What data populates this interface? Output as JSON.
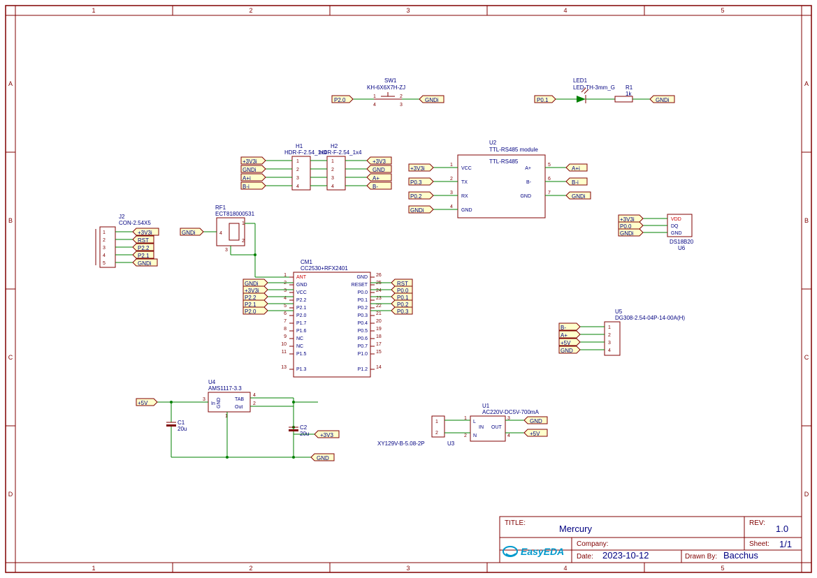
{
  "sheet": {
    "title_label": "TITLE:",
    "title": "Mercury",
    "rev_label": "REV:",
    "rev": "1.0",
    "company_label": "Company:",
    "company": "",
    "sheet_label": "Sheet:",
    "sheet": "1/1",
    "date_label": "Date:",
    "date": "2023-10-12",
    "drawn_by_label": "Drawn By:",
    "drawn_by": "Bacchus",
    "logo": "EasyEDA"
  },
  "ruler": {
    "cols": [
      "1",
      "2",
      "3",
      "4",
      "5"
    ],
    "rows": [
      "A",
      "B",
      "C",
      "D"
    ]
  },
  "components": {
    "sw1": {
      "ref": "SW1",
      "val": "KH-6X6X7H-ZJ",
      "pins": [
        "1",
        "2",
        "4",
        "3"
      ]
    },
    "led1": {
      "ref": "LED1",
      "val": "LED-TH-3mm_G"
    },
    "r1": {
      "ref": "R1",
      "val": "1k"
    },
    "h1": {
      "ref": "H1",
      "val": "HDR-F-2.54_1x4",
      "pins": [
        "1",
        "2",
        "3",
        "4"
      ]
    },
    "h2": {
      "ref": "H2",
      "val": "HDR-F-2.54_1x4",
      "pins": [
        "1",
        "2",
        "3",
        "4"
      ]
    },
    "u2": {
      "ref": "U2",
      "val": "TTL-RS485 module",
      "name": "TTL-RS485",
      "left": [
        "VCC",
        "TX",
        "RX",
        "GND"
      ],
      "leftnum": [
        "1",
        "2",
        "3",
        "4"
      ],
      "right": [
        "A+",
        "B-",
        "GND"
      ],
      "rightnum": [
        "5",
        "6",
        "7"
      ]
    },
    "j2": {
      "ref": "J2",
      "val": "CON-2.54X5",
      "pins": [
        "1",
        "2",
        "3",
        "4",
        "5"
      ]
    },
    "rf1": {
      "ref": "RF1",
      "val": "ECT818000531",
      "pins": [
        "1",
        "2",
        "3",
        "4"
      ]
    },
    "cm1": {
      "ref": "CM1",
      "val": "CC2530+RFX2401",
      "left_names": [
        "ANT",
        "GND",
        "VCC",
        "P2.2",
        "P2.1",
        "P2.0",
        "P1.7",
        "P1.6",
        "NC",
        "NC",
        "P1.5",
        "",
        "P1.3"
      ],
      "left_nums": [
        "1",
        "2",
        "3",
        "4",
        "5",
        "6",
        "7",
        "8",
        "9",
        "10",
        "11",
        "",
        "13"
      ],
      "right_names": [
        "GND",
        "RESET",
        "P0.0",
        "P0.1",
        "P0.2",
        "P0.3",
        "P0.4",
        "P0.5",
        "P0.6",
        "P0.7",
        "P1.0",
        "",
        "P1.2"
      ],
      "right_nums": [
        "26",
        "25",
        "24",
        "23",
        "22",
        "21",
        "20",
        "19",
        "18",
        "17",
        "15",
        "",
        "14"
      ]
    },
    "u6": {
      "ref": "U6",
      "val": "DS18B20",
      "pins": [
        "VDD",
        "DQ",
        "GND"
      ]
    },
    "u5": {
      "ref": "U5",
      "val": "DG308-2.54-04P-14-00A(H)",
      "pins": [
        "1",
        "2",
        "3",
        "4"
      ]
    },
    "u4": {
      "ref": "U4",
      "val": "AMS1117-3.3",
      "pins": {
        "in": "3",
        "tab": "4",
        "out": "2",
        "gnd": "1"
      },
      "labels": {
        "in": "In",
        "tab": "TAB",
        "out": "Out",
        "gnd": "GND"
      }
    },
    "c1": {
      "ref": "C1",
      "val": "20u"
    },
    "c2": {
      "ref": "C2",
      "val": "20u"
    },
    "u1": {
      "ref": "U1",
      "val": "AC220V-DC5V-700mA",
      "pins": [
        "L",
        "N",
        "OUT",
        "IN"
      ],
      "nums": [
        "1",
        "2",
        "3",
        "4"
      ]
    },
    "u3": {
      "ref": "U3",
      "val": "XY129V-B-5.08-2P",
      "pins": [
        "1",
        "2"
      ]
    }
  },
  "nets": {
    "p20": "P2.0",
    "gnd_i": "GNDi",
    "p01": "P0.1",
    "p3v3i": "+3V3i",
    "a_plus_i": "A+i",
    "b_minus_i": "B-i",
    "p03": "P0.3",
    "p02": "P0.2",
    "rst": "RST",
    "p22": "P2.2",
    "p21": "P2.1",
    "p00": "P0.0",
    "p5v": "+5V",
    "p3v3": "+3V3",
    "gnd": "GND",
    "b_minus": "B-",
    "a_plus": "A+",
    "p3v3_alt": "+3V3"
  }
}
